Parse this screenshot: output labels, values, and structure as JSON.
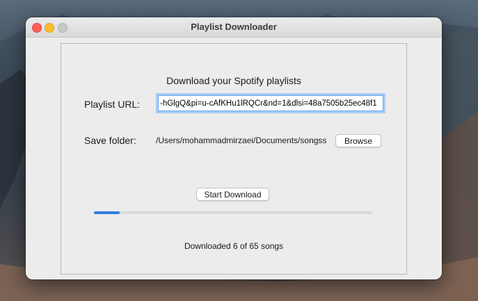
{
  "window": {
    "title": "Playlist Downloader"
  },
  "main": {
    "heading": "Download your Spotify playlists",
    "url_label": "Playlist URL:",
    "url_value": "-hGlgQ&pi=u-cAfKHu1lRQCr&nd=1&dlsi=48a7505b25ec48f1",
    "folder_label": "Save folder:",
    "folder_path": "/Users/mohammadmirzaei/Documents/songss",
    "browse_label": "Browse",
    "start_label": "Start Download",
    "progress": {
      "downloaded": 6,
      "total": 65
    },
    "status_text": "Downloaded 6 of 65 songs"
  },
  "colors": {
    "accent": "#2f7de1",
    "close": "#fe5f57",
    "minimize": "#febc2e",
    "zoom_inactive": "#c8c8c8"
  }
}
